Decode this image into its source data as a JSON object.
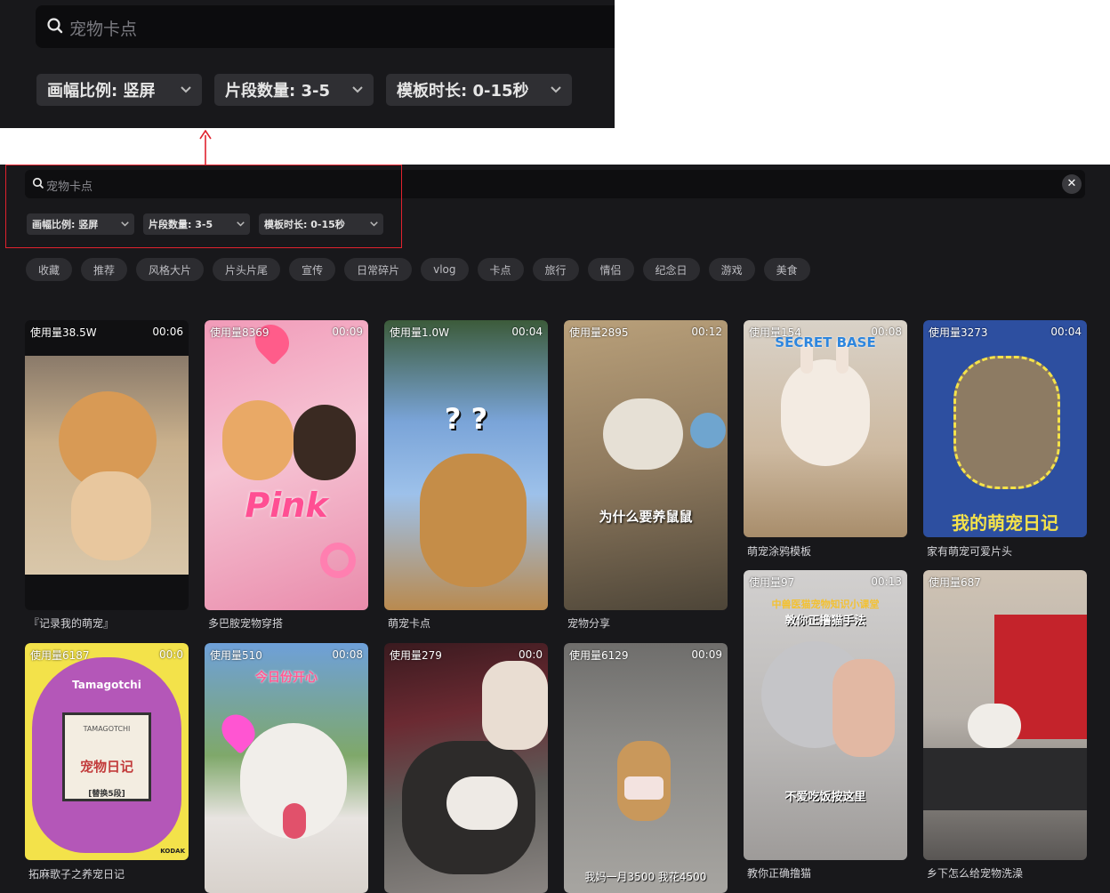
{
  "zoom": {
    "search_placeholder": "宠物卡点",
    "filters": [
      {
        "label": "画幅比例: 竖屏"
      },
      {
        "label": "片段数量: 3-5"
      },
      {
        "label": "模板时长: 0-15秒"
      }
    ]
  },
  "search": {
    "placeholder": "宠物卡点",
    "clear_icon": "✕"
  },
  "filters": [
    {
      "label": "画幅比例: 竖屏"
    },
    {
      "label": "片段数量: 3-5"
    },
    {
      "label": "模板时长: 0-15秒"
    }
  ],
  "categories": [
    "收藏",
    "推荐",
    "风格大片",
    "片头片尾",
    "宣传",
    "日常碎片",
    "vlog",
    "卡点",
    "旅行",
    "情侣",
    "纪念日",
    "游戏",
    "美食"
  ],
  "cards": [
    {
      "usage": "使用量38.5W",
      "duration": "00:06",
      "title": "『记录我的萌宠』"
    },
    {
      "usage": "使用量8369",
      "duration": "00:09",
      "title": "多巴胺宠物穿搭",
      "overlay": "Pink"
    },
    {
      "usage": "使用量1.0W",
      "duration": "00:04",
      "title": "萌宠卡点",
      "overlay": "? ?"
    },
    {
      "usage": "使用量2895",
      "duration": "00:12",
      "title": "宠物分享",
      "overlay": "为什么要养鼠鼠"
    },
    {
      "usage": "使用量154",
      "duration": "00:08",
      "title": "萌宠涂鸦模板",
      "overlay": "SECRET BASE"
    },
    {
      "usage": "使用量3273",
      "duration": "00:04",
      "title": "家有萌宠可爱片头",
      "overlay": "我的萌宠日记"
    },
    {
      "usage": "使用量97",
      "duration": "00:13",
      "title": "教你正确撸猫",
      "overlay": "敦你正撸猫手法",
      "overlay2": "不爱吃饭按这里",
      "overlay_top": "中兽医猫宠物知识小课堂"
    },
    {
      "usage": "使用量687",
      "duration": "",
      "title": "乡下怎么给宠物洗澡"
    },
    {
      "usage": "使用量6187",
      "duration": "00:0",
      "title": "拓麻歌子之养宠日记",
      "overlay": "Tamagotchi",
      "overlay2": "宠物日记",
      "overlay_small": "TAMAGOTCHI",
      "overlay_tag": "[替换5段]",
      "brand": "KODAK"
    },
    {
      "usage": "使用量510",
      "duration": "00:08",
      "title": "",
      "overlay": "今日份开心"
    },
    {
      "usage": "使用量279",
      "duration": "00:0",
      "title": ""
    },
    {
      "usage": "使用量6129",
      "duration": "00:09",
      "title": "",
      "overlay": "我妈一月3500 我花4500"
    }
  ],
  "colors": {
    "bg": "#18181b",
    "highlight": "#e0222e",
    "chip": "#2c2c30"
  }
}
